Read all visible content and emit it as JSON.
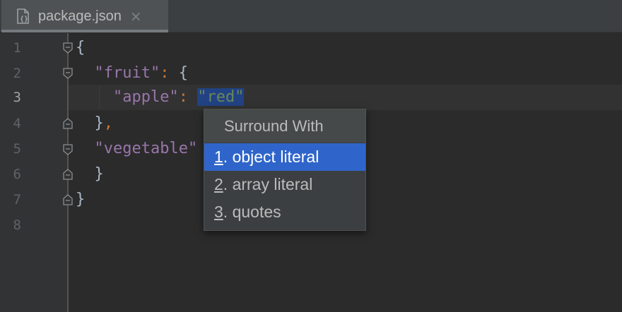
{
  "tab": {
    "filename": "package.json",
    "close_glyph": "×",
    "icon": "json-file-icon"
  },
  "gutter": {
    "line_numbers": [
      "1",
      "2",
      "3",
      "4",
      "5",
      "6",
      "7",
      "8"
    ],
    "current_line": "3"
  },
  "code": {
    "l1_brace": "{",
    "l2_key": "\"fruit\"",
    "l2_colon": ":",
    "l2_brace": "{",
    "l3_key": "\"apple\"",
    "l3_colon": ":",
    "l3_value": "\"red\"",
    "l4_brace": "}",
    "l4_comma": ",",
    "l5_key": "\"vegetable\"",
    "l6_brace": "}",
    "l7_brace": "}"
  },
  "popup": {
    "title": "Surround With",
    "items": [
      {
        "num": "1",
        "label": ". object literal"
      },
      {
        "num": "2",
        "label": ". array literal"
      },
      {
        "num": "3",
        "label": ". quotes"
      }
    ],
    "selected_index": 0
  },
  "colors": {
    "background": "#2b2b2b",
    "key": "#9876aa",
    "string": "#6a8759",
    "punctuation": "#cc7832",
    "selection": "#214283",
    "popup_active": "#2f65ca"
  }
}
